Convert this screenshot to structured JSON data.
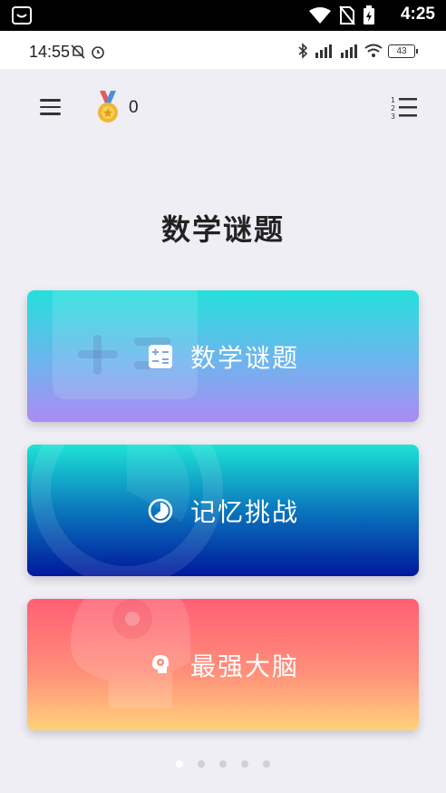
{
  "system_bar": {
    "time": "4:25"
  },
  "status_bar": {
    "time": "14:55",
    "battery": "43"
  },
  "app_bar": {
    "score": "0"
  },
  "main": {
    "title": "数学谜题",
    "cards": [
      {
        "label": "数学谜题",
        "icon": "calculator-icon"
      },
      {
        "label": "记忆挑战",
        "icon": "clock-icon"
      },
      {
        "label": "最强大脑",
        "icon": "brain-gear-icon"
      }
    ]
  },
  "pager": {
    "count": 5,
    "active_index": 0
  },
  "colors": {
    "background": "#efeef4",
    "card1_top": "#24e0dc",
    "card1_bottom": "#ab8bf3",
    "card2_top": "#1de3d6",
    "card2_bottom": "#00189c",
    "card3_top": "#ff5f74",
    "card3_bottom": "#ffd27c"
  }
}
